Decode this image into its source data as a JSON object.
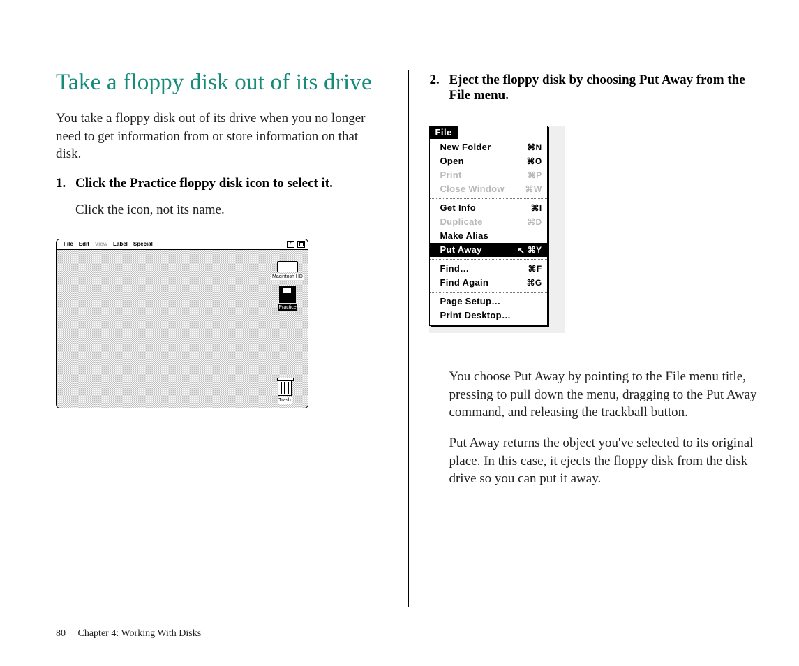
{
  "heading": "Take a floppy disk out of its drive",
  "intro": "You take a floppy disk out of its drive when you no longer need to get information from or store information on that disk.",
  "step1_num": "1.",
  "step1_text": "Click the Practice floppy disk icon to select it.",
  "step1_sub": "Click the icon, not its name.",
  "step2_num": "2.",
  "step2_text": "Eject the floppy disk by choosing Put Away from the File menu.",
  "para1": "You choose Put Away by pointing to the File menu title, pressing to pull down the menu, dragging to the Put Away command, and releasing the trackball button.",
  "para2": "Put Away returns the object you've selected to its original place. In this case, it ejects the floppy disk from the disk drive so you can put it away.",
  "page_number": "80",
  "chapter_line": "Chapter 4: Working With Disks",
  "desktop": {
    "menubar": {
      "apple_glyph": "",
      "items": [
        "File",
        "Edit",
        "View",
        "Label",
        "Special"
      ],
      "dim_index": 2
    },
    "icons": {
      "hd_label": "Macintosh HD",
      "floppy_label": "Practice",
      "trash_label": "Trash"
    }
  },
  "file_menu": {
    "title": "File",
    "groups": [
      [
        {
          "label": "New Folder",
          "shortcut": "⌘N",
          "dim": false
        },
        {
          "label": "Open",
          "shortcut": "⌘O",
          "dim": false
        },
        {
          "label": "Print",
          "shortcut": "⌘P",
          "dim": true
        },
        {
          "label": "Close Window",
          "shortcut": "⌘W",
          "dim": true
        }
      ],
      [
        {
          "label": "Get Info",
          "shortcut": "⌘I",
          "dim": false
        },
        {
          "label": "Duplicate",
          "shortcut": "⌘D",
          "dim": true
        },
        {
          "label": "Make Alias",
          "shortcut": "",
          "dim": false
        },
        {
          "label": "Put Away",
          "shortcut": "⌘Y",
          "dim": false,
          "highlight": true
        }
      ],
      [
        {
          "label": "Find…",
          "shortcut": "⌘F",
          "dim": false
        },
        {
          "label": "Find Again",
          "shortcut": "⌘G",
          "dim": false
        }
      ],
      [
        {
          "label": "Page Setup…",
          "shortcut": "",
          "dim": false
        },
        {
          "label": "Print Desktop…",
          "shortcut": "",
          "dim": false
        }
      ]
    ]
  }
}
